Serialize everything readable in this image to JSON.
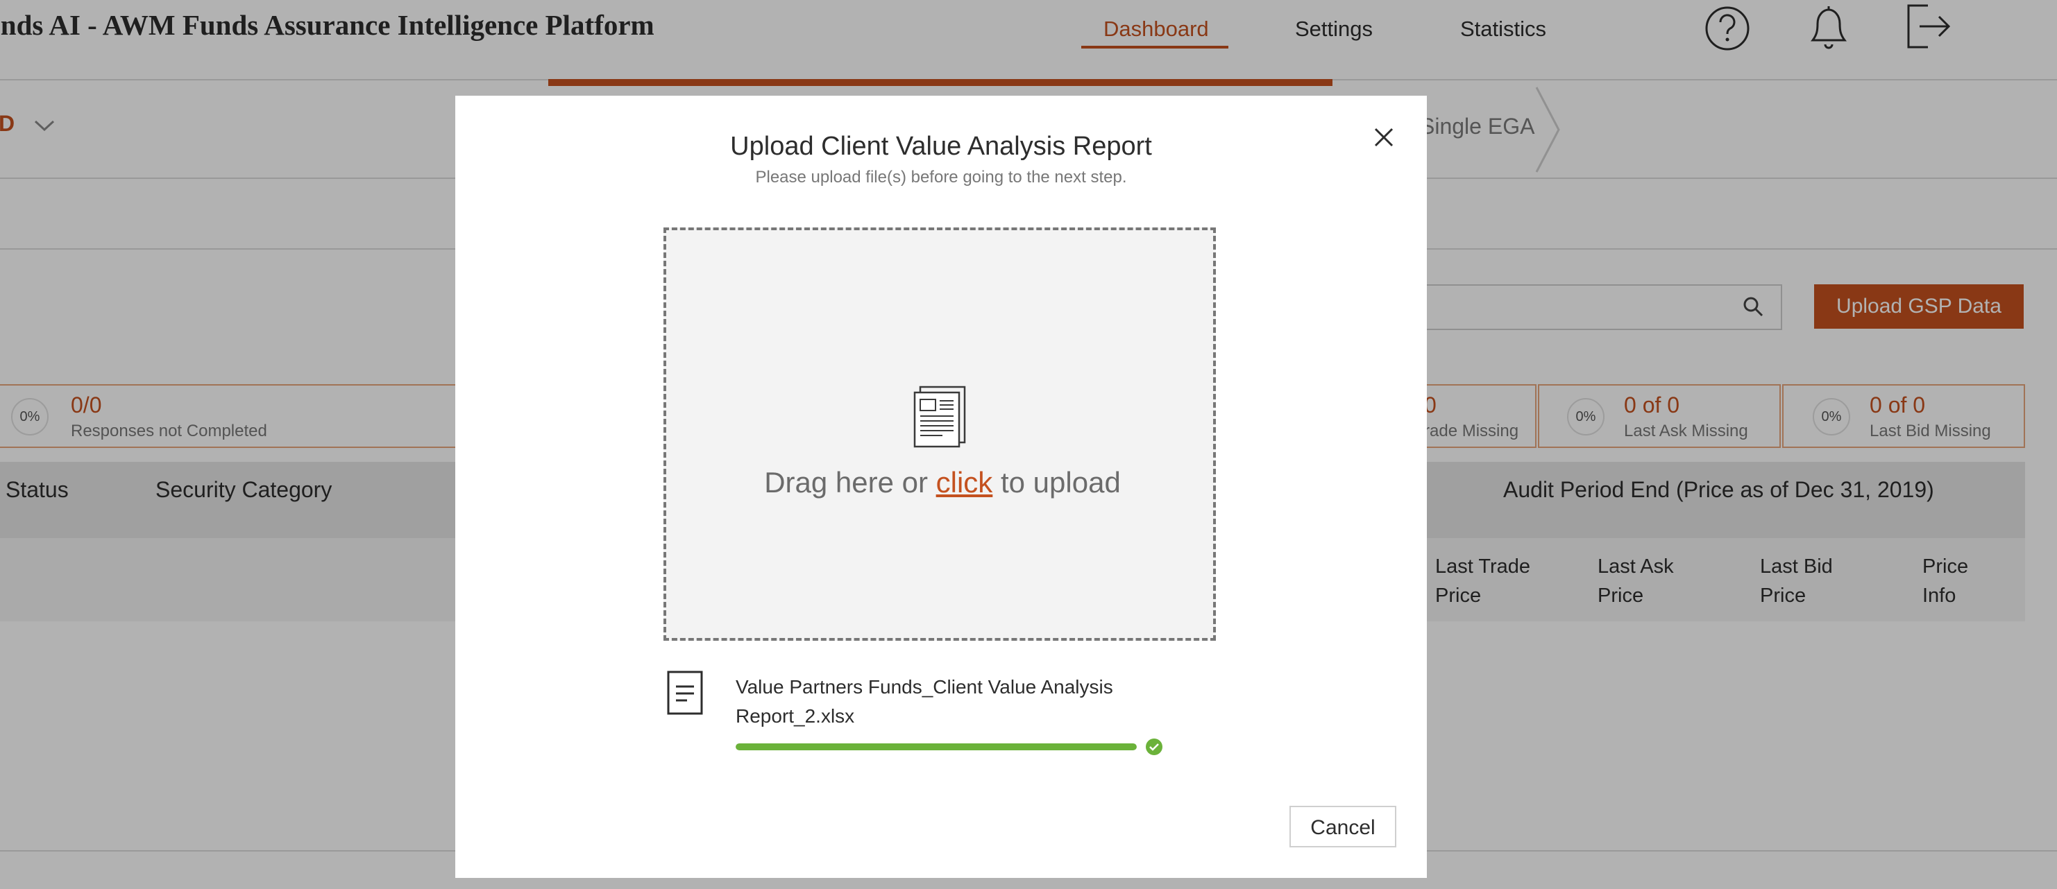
{
  "header": {
    "app_title": "unds AI - AWM Funds Assurance Intelligence Platform",
    "nav": [
      "Dashboard",
      "Settings",
      "Statistics"
    ],
    "icons": [
      "help-icon",
      "bell-icon",
      "logout-icon"
    ]
  },
  "fund_selector": {
    "label": "D"
  },
  "steps": {
    "visible_label": "Single EGA"
  },
  "toolbar": {
    "upload_gsp_label": "Upload GSP Data"
  },
  "stats": [
    {
      "percent": "0%",
      "value": "0/0",
      "label": "Responses not Completed"
    },
    {
      "value": "0",
      "label": "rade Missing"
    },
    {
      "percent": "0%",
      "value": "0 of 0",
      "label": "Last Ask Missing"
    },
    {
      "percent": "0%",
      "value": "0 of 0",
      "label": "Last Bid Missing"
    }
  ],
  "table": {
    "headers": [
      "Status",
      "Security Category",
      "Audit Period End (Price as of Dec 31, 2019)"
    ],
    "subheaders": [
      "Last Trade Price",
      "Last Ask Price",
      "Last Bid Price",
      "Price Info"
    ]
  },
  "modal": {
    "title": "Upload Client Value Analysis Report",
    "subtitle": "Please upload file(s) before going to the next step.",
    "drop_prefix": "Drag here or ",
    "drop_link": "click",
    "drop_suffix": " to upload",
    "file_name": "Value Partners Funds_Client Value Analysis Report_2.xlsx",
    "upload_progress": 1.0,
    "cancel_label": "Cancel"
  },
  "colors": {
    "accent": "#c4511f",
    "success": "#6bb23a"
  }
}
